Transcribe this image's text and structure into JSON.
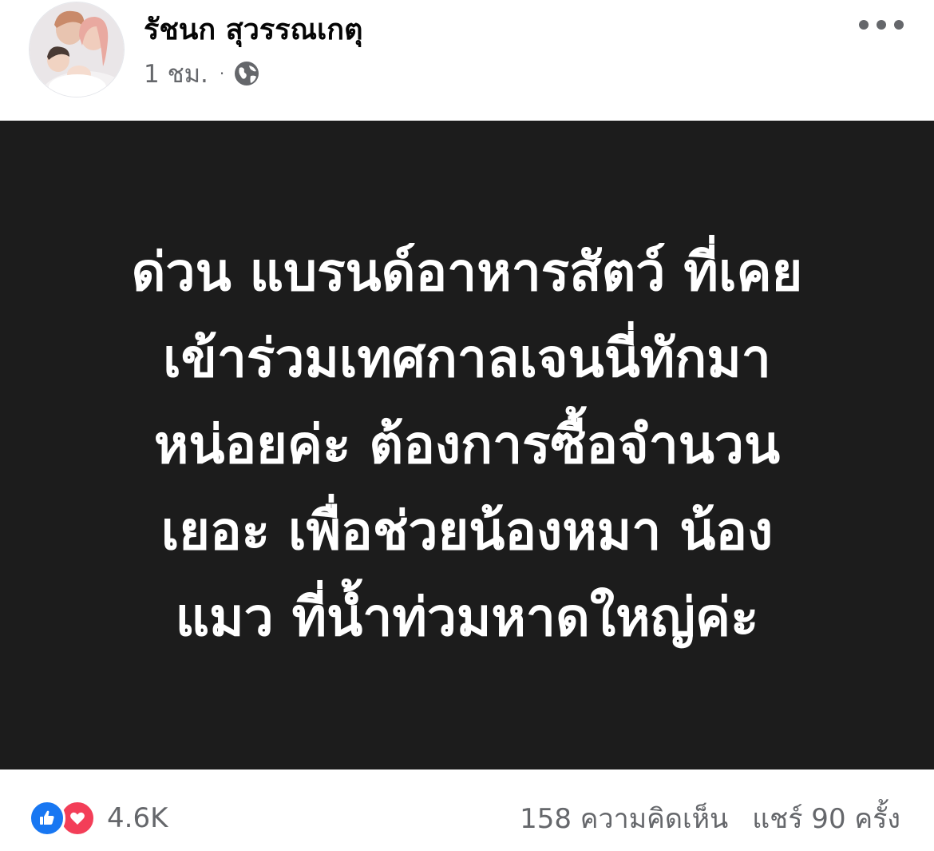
{
  "post": {
    "author": "รัชนก สุวรรณเกตุ",
    "time": "1 ชม.",
    "separator": "·",
    "audience_icon": "globe-icon",
    "menu_icon": "more-dots-icon",
    "lines": [
      "ด่วน แบรนด์อาหารสัตว์ ที่เคย",
      "เข้าร่วมเทศกาลเจนนี่ทักมา",
      "หน่อยค่ะ ต้องการซื้อจำนวน",
      "เยอะ เพื่อช่วยน้องหมา น้อง",
      "แมว ที่น้ำท่วมหาดใหญ่ค่ะ"
    ],
    "background_color": "#1c1c1c",
    "text_color": "#ffffff"
  },
  "footer": {
    "reaction_icons": [
      "like-icon",
      "love-icon"
    ],
    "reaction_count": "4.6K",
    "comments": "158 ความคิดเห็น",
    "shares": "แชร์ 90 ครั้ง"
  },
  "colors": {
    "like": "#1877f2",
    "love": "#f33e58",
    "secondary_text": "#65676b"
  }
}
